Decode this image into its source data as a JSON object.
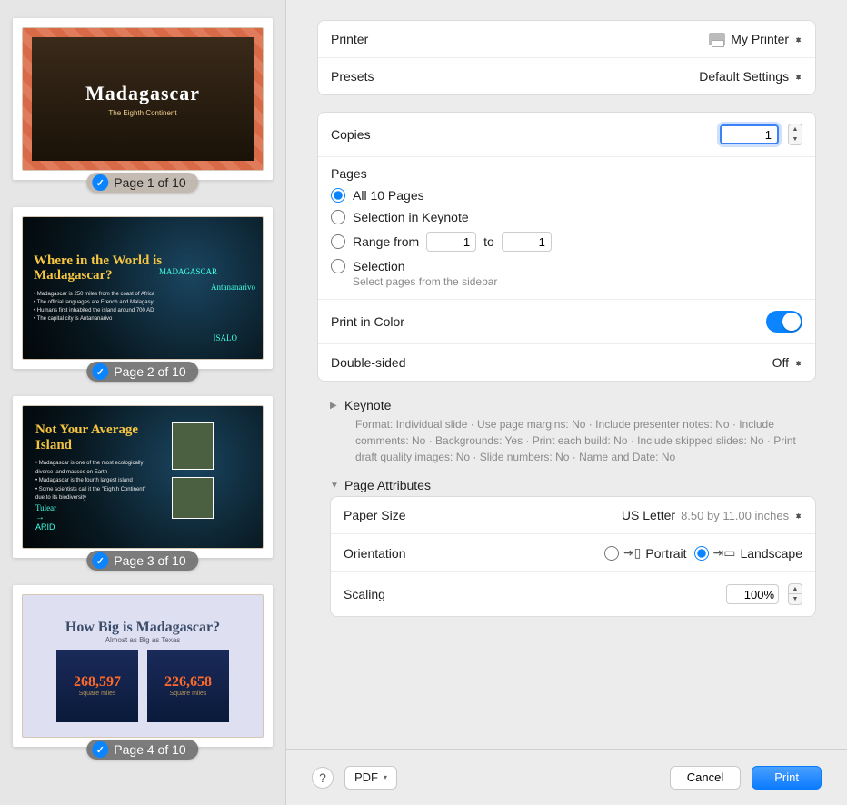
{
  "sidebar": {
    "thumbs": [
      {
        "badge": "Page 1 of 10",
        "title": "Madagascar",
        "subtitle": "The Eighth Continent",
        "badgeClass": ""
      },
      {
        "badge": "Page 2 of 10",
        "title": "Where in the World is Madagascar?",
        "badgeClass": "dark"
      },
      {
        "badge": "Page 3 of 10",
        "title": "Not Your Average Island",
        "badgeClass": "dark"
      },
      {
        "badge": "Page 4 of 10",
        "title": "How Big is Madagascar?",
        "subtitle": "Almost as Big as Texas",
        "num1": "268,597",
        "num2": "226,658",
        "sq": "Square miles",
        "badgeClass": "dark"
      }
    ],
    "slide2_labels": {
      "a": "MADAGASCAR",
      "b": "Antananarivo",
      "c": "ISALO"
    },
    "slide2_bullets": "• Madagascar is 250 miles from the coast of Africa\n• The official languages are French and Malagasy\n• Humans first inhabited the island around 700 AD\n• The capital city is Antananarivo",
    "slide3_bullets": "• Madagascar is one of the most ecologically diverse land masses on Earth\n• Madagascar is the fourth largest island\n• Some scientists call it the \"Eighth Continent\" due to its biodiversity",
    "slide3_labels": {
      "a": "Tulear",
      "b": "→",
      "c": "ARID"
    }
  },
  "printer": {
    "label": "Printer",
    "value": "My Printer"
  },
  "presets": {
    "label": "Presets",
    "value": "Default Settings"
  },
  "copies": {
    "label": "Copies",
    "value": "1"
  },
  "pages": {
    "label": "Pages",
    "all": "All 10 Pages",
    "selectionApp": "Selection in Keynote",
    "rangeFrom": "Range from",
    "rangeTo": "to",
    "rangeFromVal": "1",
    "rangeToVal": "1",
    "selection": "Selection",
    "selectionHint": "Select pages from the sidebar"
  },
  "color": {
    "label": "Print in Color"
  },
  "duplex": {
    "label": "Double-sided",
    "value": "Off"
  },
  "keynote": {
    "label": "Keynote",
    "details": "Format: Individual slide · Use page margins: No · Include presenter notes: No · Include comments: No · Backgrounds: Yes · Print each build: No · Include skipped slides: No · Print draft quality images: No · Slide numbers: No · Name and Date: No"
  },
  "pageAttr": {
    "label": "Page Attributes",
    "paperSize": {
      "label": "Paper Size",
      "value": "US Letter",
      "dim": "8.50 by 11.00 inches"
    },
    "orientation": {
      "label": "Orientation",
      "portrait": "Portrait",
      "landscape": "Landscape"
    },
    "scaling": {
      "label": "Scaling",
      "value": "100%"
    }
  },
  "footer": {
    "help": "?",
    "pdf": "PDF",
    "cancel": "Cancel",
    "print": "Print"
  }
}
